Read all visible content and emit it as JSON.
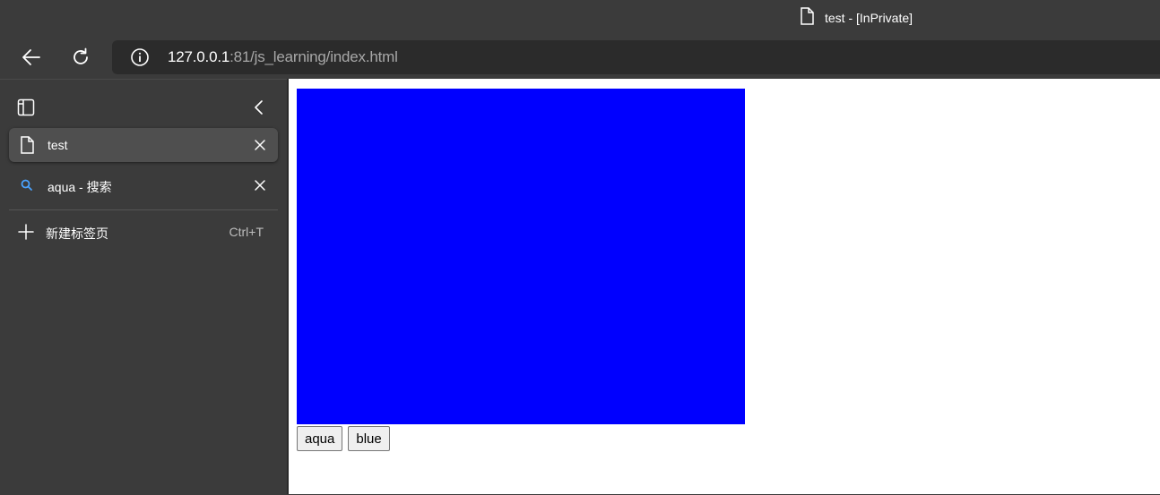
{
  "window": {
    "title": "test - [InPrivate]"
  },
  "toolbar": {
    "url_host": "127.0.0.1",
    "url_rest": ":81/js_learning/index.html"
  },
  "sidebar": {
    "tabs": [
      {
        "label": "test",
        "icon": "page-icon",
        "active": true
      },
      {
        "label": "aqua - 搜索",
        "icon": "search-icon",
        "active": false
      }
    ],
    "new_tab": {
      "label": "新建标签页",
      "shortcut": "Ctrl+T"
    }
  },
  "page": {
    "box_color": "#0000ff",
    "buttons": [
      {
        "label": "aqua"
      },
      {
        "label": "blue"
      }
    ]
  },
  "colors": {
    "chrome_bg": "#3b3b3b",
    "address_bg": "#2b2b2b",
    "search_icon": "#4aa3ff"
  }
}
